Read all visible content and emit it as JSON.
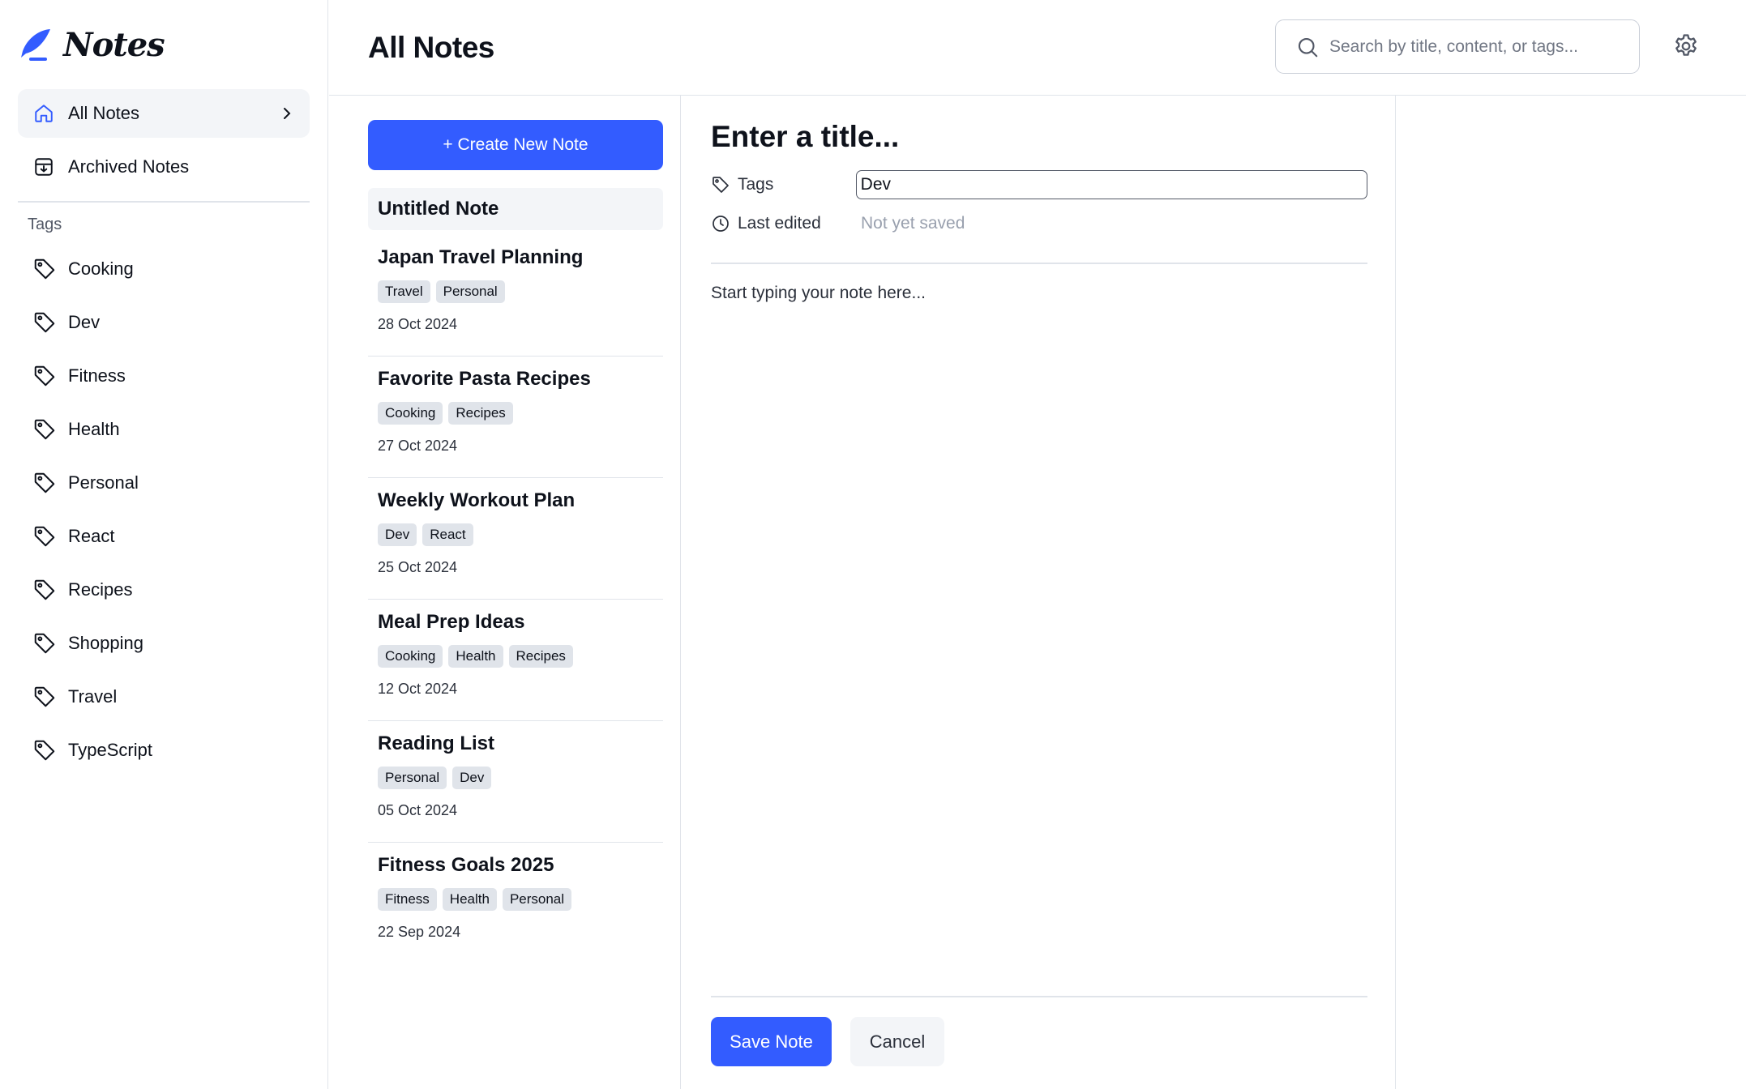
{
  "app": {
    "name": "Notes"
  },
  "sidebar": {
    "nav": [
      {
        "label": "All Notes",
        "icon": "home-icon",
        "active": true
      },
      {
        "label": "Archived Notes",
        "icon": "archive-icon",
        "active": false
      }
    ],
    "tags_heading": "Tags",
    "tags": [
      "Cooking",
      "Dev",
      "Fitness",
      "Health",
      "Personal",
      "React",
      "Recipes",
      "Shopping",
      "Travel",
      "TypeScript"
    ]
  },
  "header": {
    "title": "All Notes",
    "search_placeholder": "Search by title, content, or tags..."
  },
  "notes_list": {
    "create_label": "+ Create New Note",
    "untitled_label": "Untitled Note",
    "notes": [
      {
        "title": "Japan Travel Planning",
        "tags": [
          "Travel",
          "Personal"
        ],
        "date": "28 Oct 2024"
      },
      {
        "title": "Favorite Pasta Recipes",
        "tags": [
          "Cooking",
          "Recipes"
        ],
        "date": "27 Oct 2024"
      },
      {
        "title": "Weekly Workout Plan",
        "tags": [
          "Dev",
          "React"
        ],
        "date": "25 Oct 2024"
      },
      {
        "title": "Meal Prep Ideas",
        "tags": [
          "Cooking",
          "Health",
          "Recipes"
        ],
        "date": "12 Oct 2024"
      },
      {
        "title": "Reading List",
        "tags": [
          "Personal",
          "Dev"
        ],
        "date": "05 Oct 2024"
      },
      {
        "title": "Fitness Goals 2025",
        "tags": [
          "Fitness",
          "Health",
          "Personal"
        ],
        "date": "22 Sep 2024"
      }
    ]
  },
  "editor": {
    "title_placeholder": "Enter a title...",
    "tags_label": "Tags",
    "tags_value": "Dev",
    "last_edited_label": "Last edited",
    "last_edited_value": "Not yet saved",
    "content_placeholder": "Start typing your note here...",
    "save_label": "Save Note",
    "cancel_label": "Cancel"
  },
  "colors": {
    "accent": "#335cff",
    "border": "#e0e4ea",
    "muted": "#99a0ae",
    "chip_bg": "#e0e4ea",
    "active_bg": "#f3f5f8"
  }
}
